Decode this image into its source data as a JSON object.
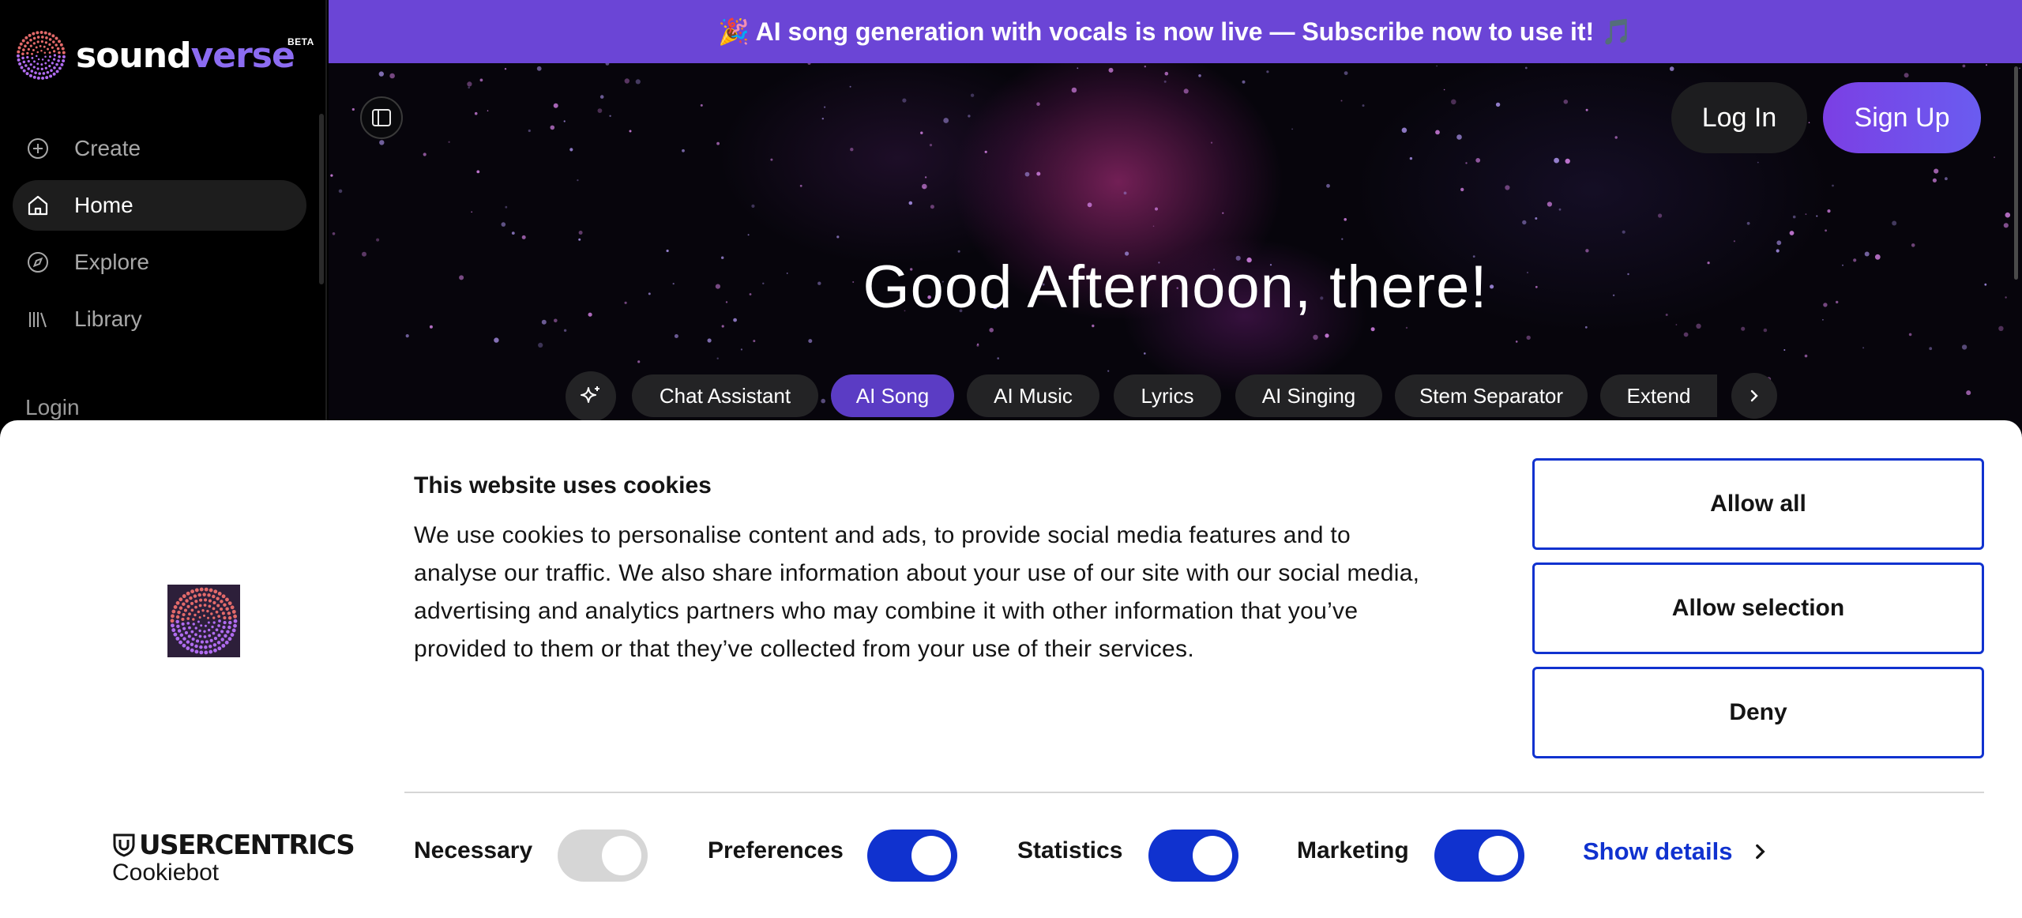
{
  "brand": {
    "name_part1": "sound",
    "name_part2": "verse",
    "badge": "BETA"
  },
  "sidebar": {
    "items": [
      {
        "label": "Create",
        "icon": "plus-circle-icon"
      },
      {
        "label": "Home",
        "icon": "home-icon",
        "active": true
      },
      {
        "label": "Explore",
        "icon": "compass-icon"
      },
      {
        "label": "Library",
        "icon": "library-icon"
      }
    ],
    "login_label": "Login"
  },
  "banner": {
    "text": "🎉 AI song generation with vocals is now live — Subscribe now to use it! 🎵"
  },
  "header": {
    "login_label": "Log In",
    "signup_label": "Sign Up"
  },
  "hero": {
    "greeting": "Good Afternoon, there!"
  },
  "tabs": [
    {
      "label": "Chat Assistant"
    },
    {
      "label": "AI Song",
      "active": true
    },
    {
      "label": "AI Music"
    },
    {
      "label": "Lyrics"
    },
    {
      "label": "AI Singing"
    },
    {
      "label": "Stem Separator"
    },
    {
      "label": "Extend"
    }
  ],
  "cookie": {
    "title": "This website uses cookies",
    "body": "We use cookies to personalise content and ads, to provide social media features and to analyse our traffic. We also share information about your use of our site with our social media, advertising and analytics partners who may combine it with other information that you’ve provided to them or that they’ve collected from your use of their services.",
    "allow_all": "Allow all",
    "allow_selection": "Allow selection",
    "deny": "Deny",
    "provider_name": "USERCENTRICS",
    "provider_sub": "Cookiebot",
    "toggles": [
      {
        "label": "Necessary",
        "on": true,
        "disabled": true
      },
      {
        "label": "Preferences",
        "on": true
      },
      {
        "label": "Statistics",
        "on": true
      },
      {
        "label": "Marketing",
        "on": true
      }
    ],
    "show_details": "Show details"
  },
  "colors": {
    "accent": "#6b45d6",
    "tab_active": "#5b3cc4",
    "cookie_blue": "#1032cf",
    "toggle_disabled": "#d6d6d6"
  }
}
